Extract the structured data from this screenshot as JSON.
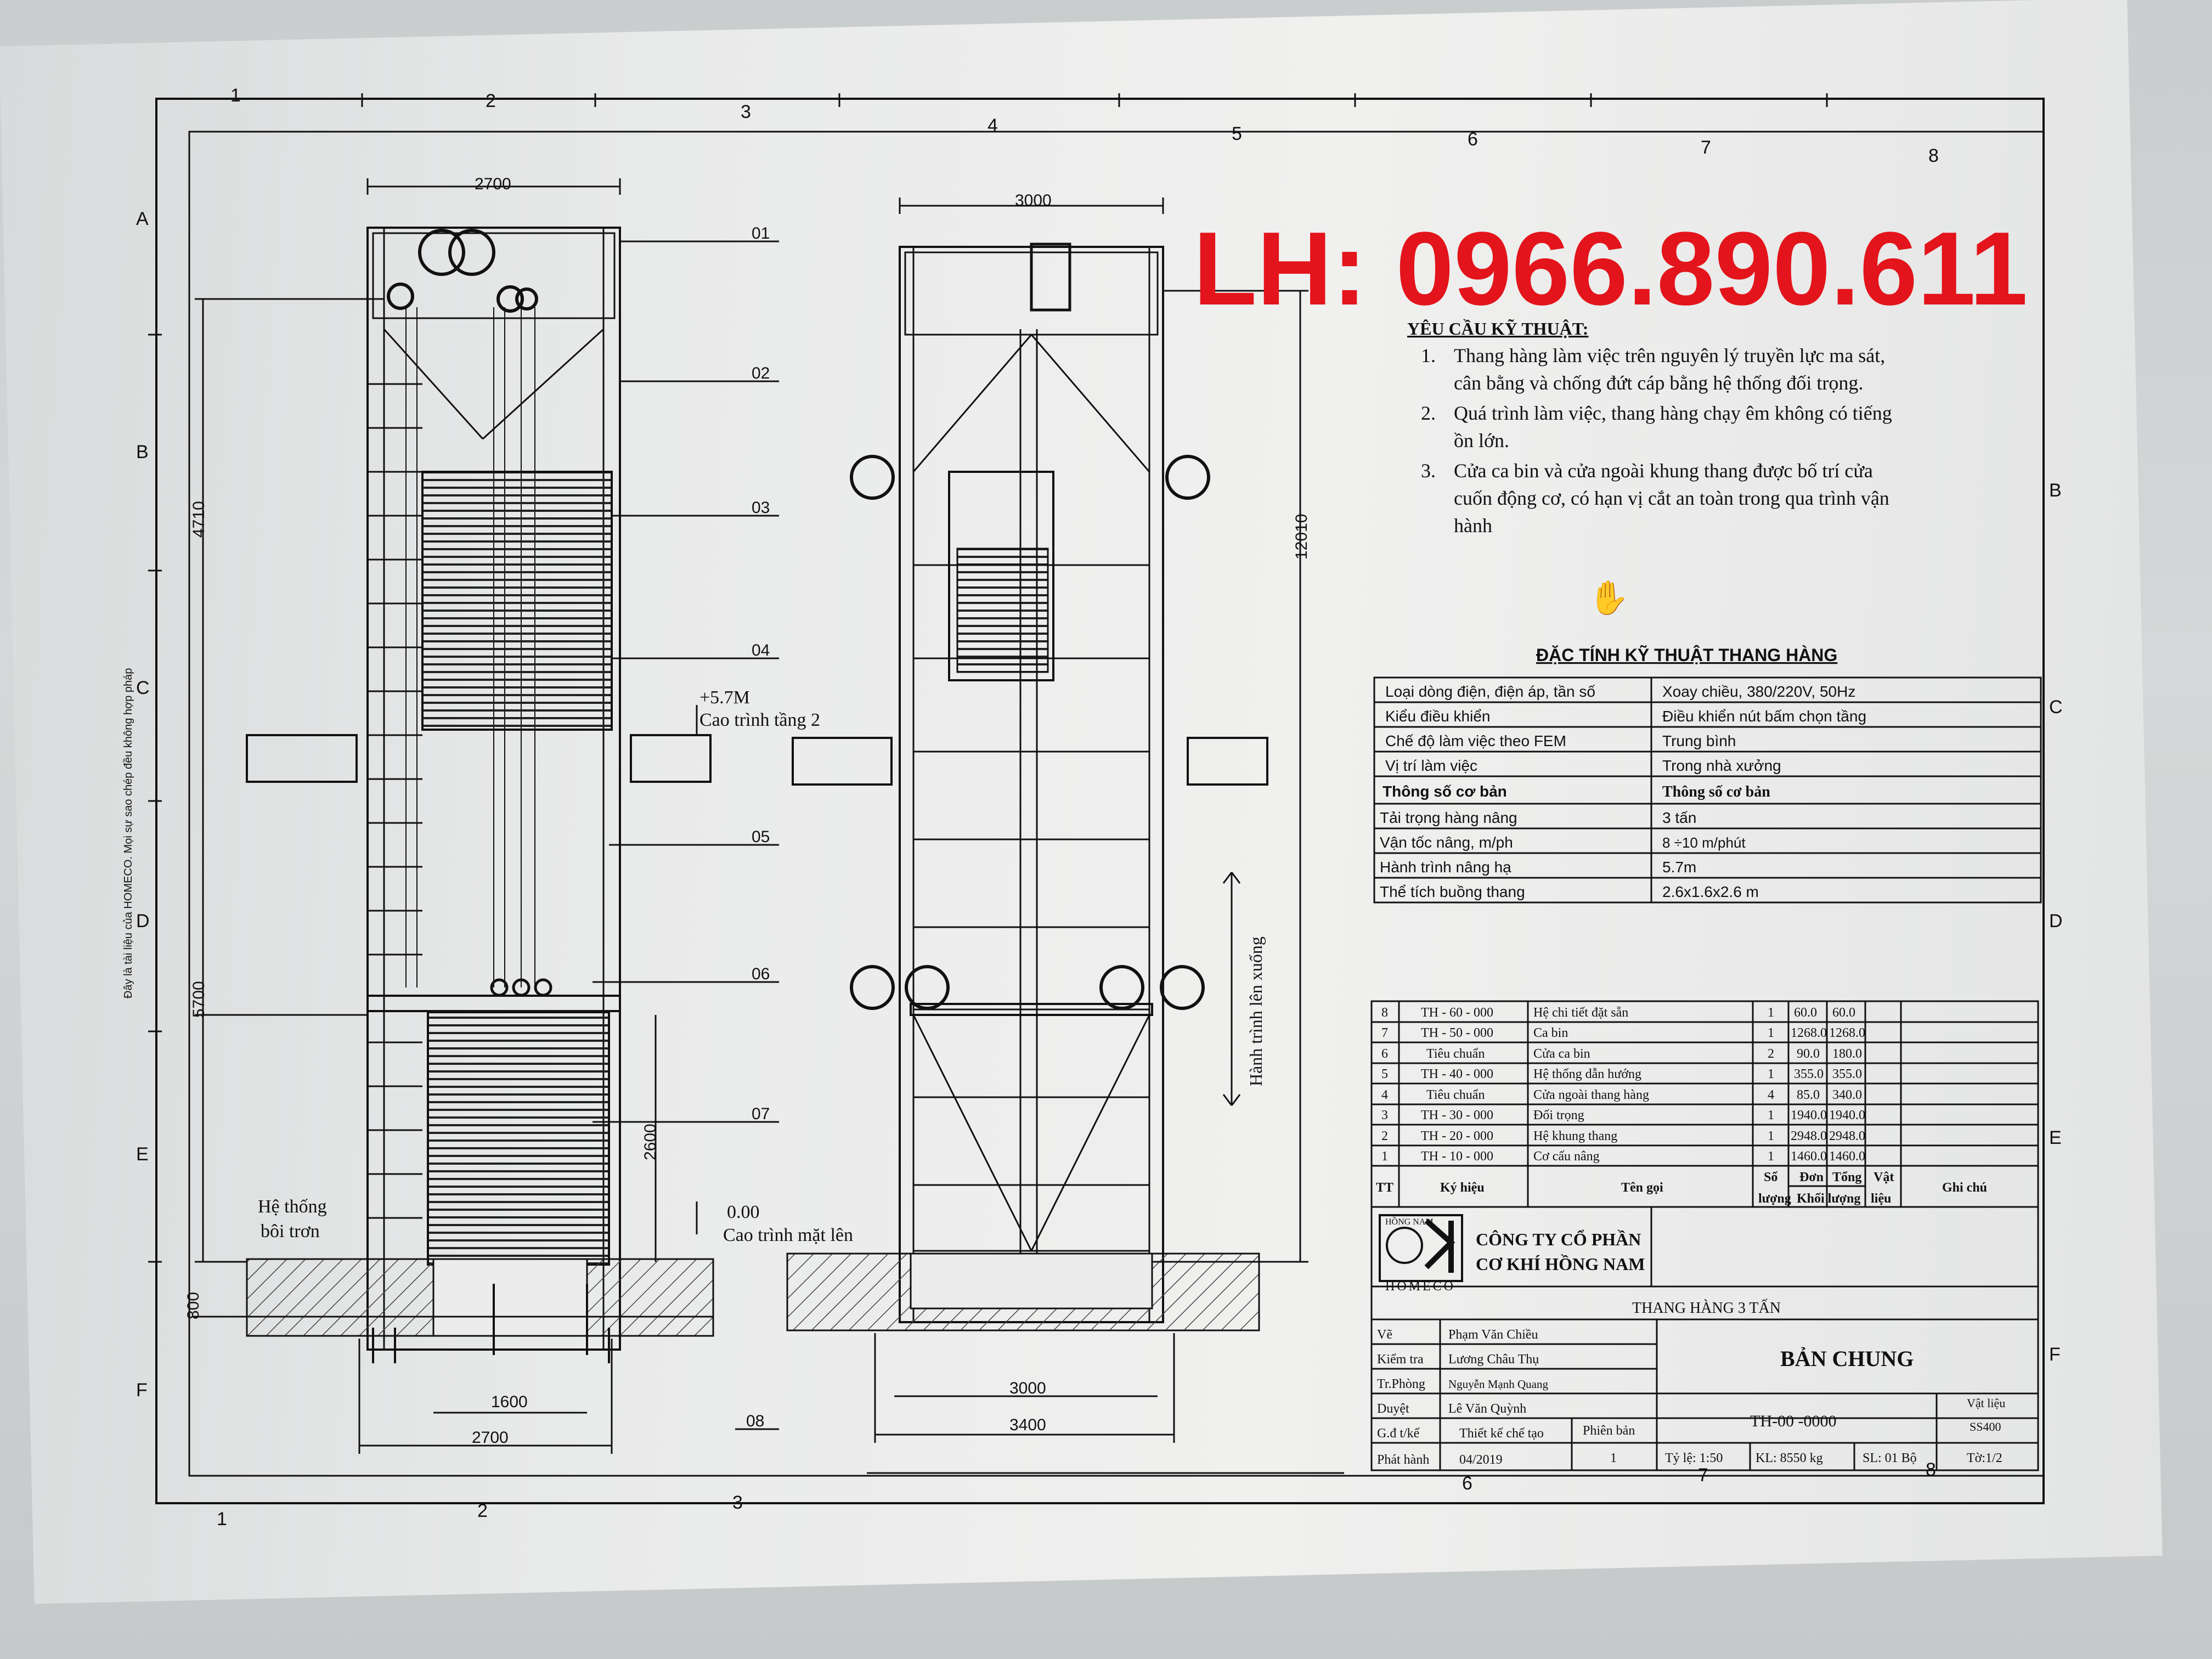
{
  "contact": {
    "text": "LH: 0966.890.611",
    "color": "#e3141b"
  },
  "side_note": "Đây là tài liệu của HOMECO. Mọi sự sao chép đều không hợp pháp",
  "grid": {
    "top_cols": [
      "1",
      "2",
      "3",
      "4",
      "5",
      "6",
      "7",
      "8"
    ],
    "bottom_cols": [
      "1",
      "2",
      "3",
      "6",
      "7",
      "8"
    ],
    "rows": [
      "A",
      "B",
      "C",
      "D",
      "E",
      "F"
    ]
  },
  "elevation_left": {
    "dims": {
      "top_width": "2700",
      "h_4710": "4710",
      "h_5700": "5700",
      "h_2600": "2600",
      "h_800": "800",
      "bottom_1600": "1600",
      "bottom_2700": "2700"
    },
    "level_top": {
      "value": "+5.7M",
      "label": "Cao trình tầng 2"
    },
    "level_ground": {
      "value": "0.00",
      "label": "Cao trình mặt lên"
    },
    "lubrication": [
      "Hệ thống",
      "bôi trơn"
    ]
  },
  "callouts": [
    "01",
    "02",
    "03",
    "04",
    "05",
    "06",
    "07",
    "08"
  ],
  "elevation_right": {
    "dims": {
      "top_width": "3000",
      "h_12010": "12010",
      "bottom_3000": "3000",
      "bottom_3400": "3400"
    },
    "travel_label": "Hành trình lên xuống"
  },
  "requirements": {
    "title": "YÊU CẦU KỸ THUẬT:",
    "items": [
      {
        "num": "1.",
        "lines": [
          "Thang hàng làm việc trên nguyên lý truyền lực ma sát,",
          "cân bằng và chống đứt cáp bằng hệ thống đối trọng."
        ]
      },
      {
        "num": "2.",
        "lines": [
          "Quá trình làm việc, thang hàng chạy êm không có tiếng",
          "ồn lớn."
        ]
      },
      {
        "num": "3.",
        "lines": [
          "Cửa ca bin và cửa ngoài khung thang được bố trí cửa",
          "cuốn động cơ, có hạn vị cắt an toàn trong qua trình vận",
          "hành"
        ]
      }
    ]
  },
  "spec": {
    "title": "ĐẶC TÍNH KỸ THUẬT THANG HÀNG",
    "rows": [
      [
        "Loại dòng điện, điện áp, tần số",
        "Xoay chiều, 380/220V, 50Hz"
      ],
      [
        "Kiểu điều khiển",
        "Điều khiển nút bấm chọn tầng"
      ],
      [
        "Chế độ làm việc theo FEM",
        "Trung bình"
      ],
      [
        "Vị trí làm việc",
        "Trong nhà xưởng"
      ],
      [
        "Thông số cơ bản",
        "Thông số cơ bản"
      ],
      [
        "Tải trọng hàng nâng",
        "3 tấn"
      ],
      [
        "Vận tốc nâng, m/ph",
        "8 ÷10 m/phút"
      ],
      [
        "Hành trình nâng hạ",
        "5.7m"
      ],
      [
        "Thể tích buồng thang",
        "2.6x1.6x2.6 m"
      ]
    ]
  },
  "bom": {
    "rows": [
      [
        "8",
        "TH - 60 - 000",
        "Hệ chi tiết đặt sẵn",
        "1",
        "60.0",
        "60.0"
      ],
      [
        "7",
        "TH - 50 - 000",
        "Ca bin",
        "1",
        "1268.0",
        "1268.0"
      ],
      [
        "6",
        "Tiêu chuẩn",
        "Cửa ca bin",
        "2",
        "90.0",
        "180.0"
      ],
      [
        "5",
        "TH - 40 - 000",
        "Hệ thống dẫn hướng",
        "1",
        "355.0",
        "355.0"
      ],
      [
        "4",
        "Tiêu chuẩn",
        "Cửa ngoài thang hàng",
        "4",
        "85.0",
        "340.0"
      ],
      [
        "3",
        "TH - 30 - 000",
        "Đối trọng",
        "1",
        "1940.0",
        "1940.0"
      ],
      [
        "2",
        "TH - 20 - 000",
        "Hệ khung thang",
        "1",
        "2948.0",
        "2948.0"
      ],
      [
        "1",
        "TH - 10 - 000",
        "Cơ cấu nâng",
        "1",
        "1460.0",
        "1460.0"
      ]
    ],
    "header": {
      "tt": "TT",
      "ky_hieu": "Ký hiệu",
      "ten_goi": "Tên gọi",
      "so_luong": [
        "Số",
        "lượng"
      ],
      "don": "Đơn",
      "tong": "Tổng",
      "khoi_luong": "Khối lượng",
      "vat_lieu": [
        "Vật",
        "liệu"
      ],
      "ghi_chu": "Ghi chú"
    }
  },
  "title_block": {
    "company": [
      "CÔNG TY CỔ PHẦN",
      "CƠ KHÍ HỒNG NAM"
    ],
    "logo_text": "HOMECO",
    "logo_top": "HỒNG NAM",
    "product": "THANG HÀNG 3 TẤN",
    "drawing": "BẢN CHUNG",
    "code": "TH-00 -0000",
    "material_label": "Vật liệu",
    "material": "SS400",
    "roles": [
      [
        "Vẽ",
        "Phạm Văn Chiều"
      ],
      [
        "Kiểm tra",
        "Lương Châu Thụ"
      ],
      [
        "Tr.Phòng",
        "Nguyễn Mạnh Quang"
      ],
      [
        "Duyệt",
        "Lê Văn Quỳnh"
      ],
      [
        "G.đ t/kế",
        "Thiết kế chế tạo"
      ],
      [
        "Phát hành",
        "04/2019"
      ]
    ],
    "phien_ban_label": "Phiên bản",
    "phien_ban": "1",
    "scale": "Tỷ lệ: 1:50",
    "weight": "KL: 8550 kg",
    "sets": "SL: 01 Bộ",
    "sheet": "Tờ:1/2"
  }
}
